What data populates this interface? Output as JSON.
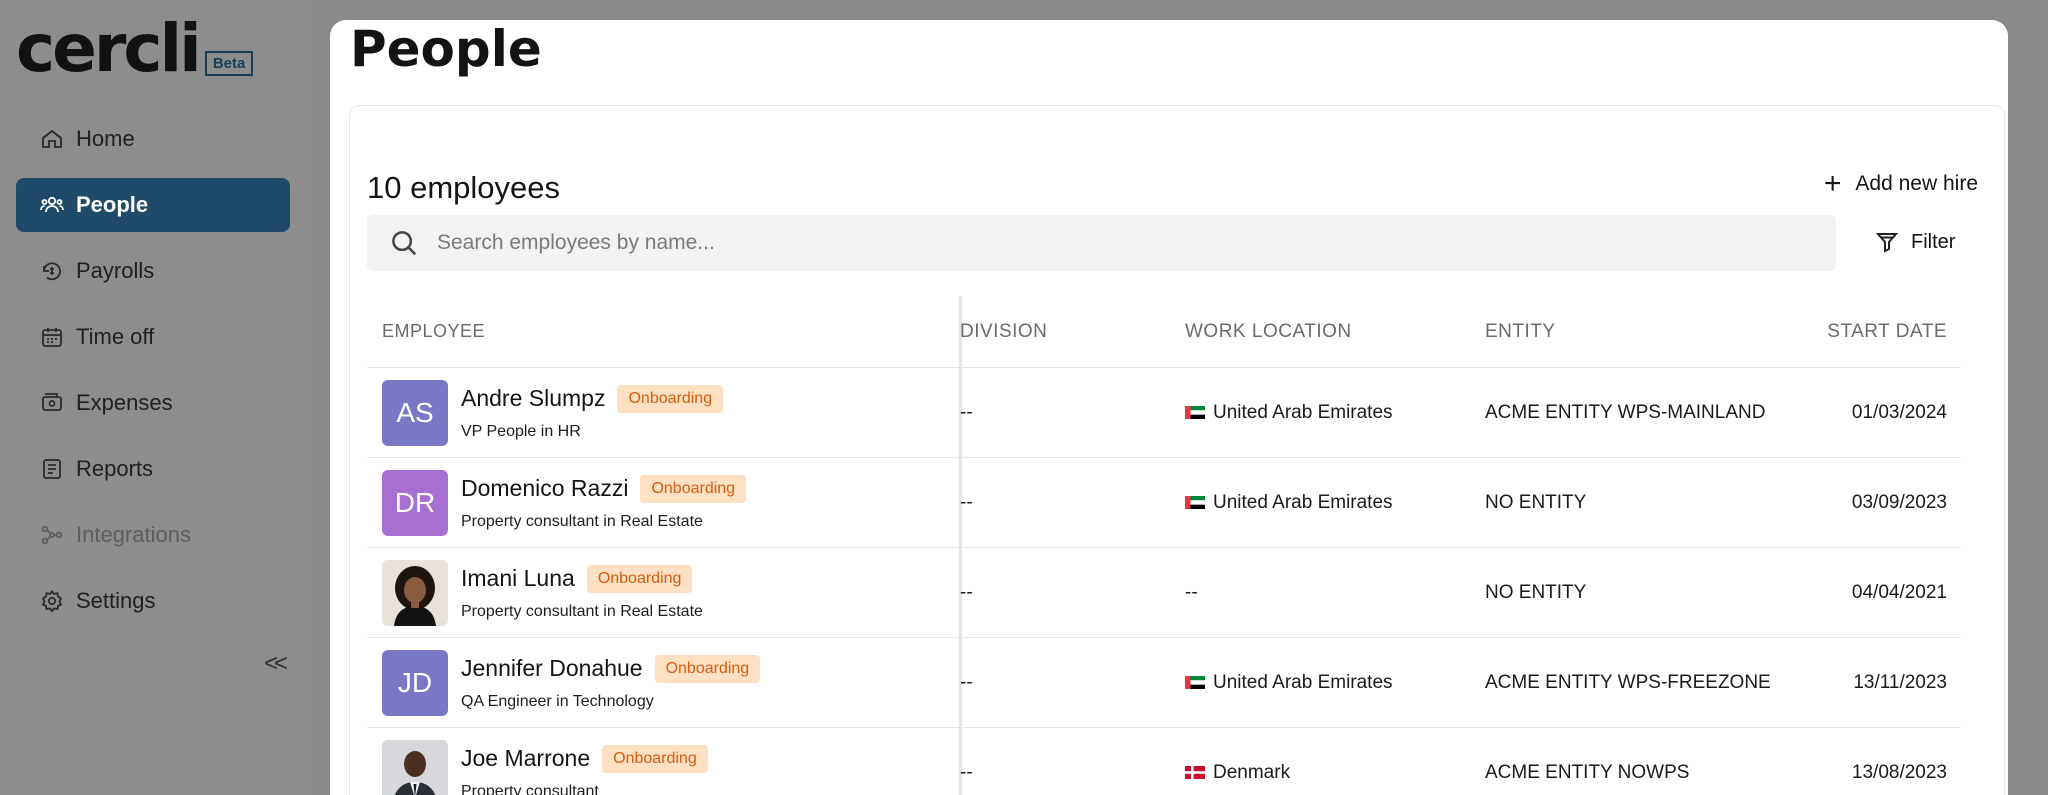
{
  "brand": {
    "logo_text": "cercli",
    "beta_label": "Beta"
  },
  "sidebar": {
    "items": [
      {
        "label": "Home",
        "icon": "home-icon"
      },
      {
        "label": "People",
        "icon": "people-icon",
        "active": true
      },
      {
        "label": "Payrolls",
        "icon": "payroll-icon"
      },
      {
        "label": "Time off",
        "icon": "calendar-icon"
      },
      {
        "label": "Expenses",
        "icon": "wallet-icon"
      },
      {
        "label": "Reports",
        "icon": "report-icon"
      },
      {
        "label": "Integrations",
        "icon": "integrations-icon",
        "disabled": true
      },
      {
        "label": "Settings",
        "icon": "gear-icon"
      }
    ],
    "collapse_glyph": "<<"
  },
  "page": {
    "title": "People",
    "employee_count": "10 employees",
    "add_hire_label": "Add new hire",
    "filter_label": "Filter",
    "search_placeholder": "Search employees by name..."
  },
  "table": {
    "headers": {
      "employee": "EMPLOYEE",
      "division": "DIVISION",
      "work_location": "WORK LOCATION",
      "entity": "ENTITY",
      "start_date": "START DATE"
    },
    "rows": [
      {
        "initials": "AS",
        "avatar_color": "#7b77c7",
        "name": "Andre Slumpz",
        "status": "Onboarding",
        "role": "VP People in HR",
        "division": "--",
        "location": "United Arab Emirates",
        "flag": "uae",
        "entity": "ACME ENTITY WPS-MAINLAND",
        "start_date": "01/03/2024"
      },
      {
        "initials": "DR",
        "avatar_color": "#a66fd1",
        "name": "Domenico Razzi",
        "status": "Onboarding",
        "role": "Property consultant in Real Estate",
        "division": "--",
        "location": "United Arab Emirates",
        "flag": "uae",
        "entity": "NO ENTITY",
        "start_date": "03/09/2023"
      },
      {
        "initials": "",
        "avatar_color": "#c9b9a8",
        "name": "Imani Luna",
        "status": "Onboarding",
        "role": "Property consultant in Real Estate",
        "division": "--",
        "location": "--",
        "flag": "",
        "entity": "NO ENTITY",
        "start_date": "04/04/2021"
      },
      {
        "initials": "JD",
        "avatar_color": "#7b77c7",
        "name": "Jennifer Donahue",
        "status": "Onboarding",
        "role": "QA Engineer in Technology",
        "division": "--",
        "location": "United Arab Emirates",
        "flag": "uae",
        "entity": "ACME ENTITY WPS-FREEZONE",
        "start_date": "13/11/2023"
      },
      {
        "initials": "",
        "avatar_color": "#b9bdc4",
        "name": "Joe Marrone",
        "status": "Onboarding",
        "role": "Property consultant",
        "division": "--",
        "location": "Denmark",
        "flag": "denmark",
        "entity": "ACME ENTITY NOWPS",
        "start_date": "13/08/2023"
      }
    ]
  }
}
